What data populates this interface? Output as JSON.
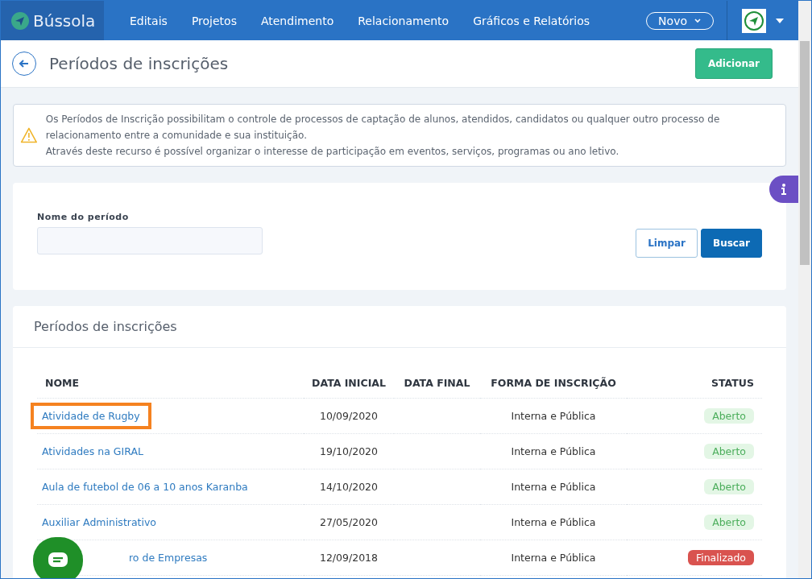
{
  "brand": "Bússola",
  "nav": [
    {
      "label": "Editais"
    },
    {
      "label": "Projetos"
    },
    {
      "label": "Atendimento"
    },
    {
      "label": "Relacionamento"
    },
    {
      "label": "Gráficos e Relatórios"
    }
  ],
  "new_button": "Novo",
  "page_title": "Períodos de inscrições",
  "add_button": "Adicionar",
  "alert": [
    "Os Períodos de Inscrição possibilitam o controle de processos de captação de alunos, atendidos, candidatos ou qualquer outro processo de relacionamento entre a comunidade e sua instituição.",
    "Através deste recurso é possível organizar o interesse de participação em eventos, serviços, programas ou ano letivo."
  ],
  "filter": {
    "label": "Nome do período",
    "clear_button": "Limpar",
    "search_button": "Buscar"
  },
  "table": {
    "title": "Períodos de inscrições",
    "columns": [
      "NOME",
      "DATA INICIAL",
      "DATA FINAL",
      "FORMA DE INSCRIÇÃO",
      "STATUS"
    ],
    "rows": [
      {
        "name": "Atividade de Rugby",
        "start": "10/09/2020",
        "end": "",
        "form": "Interna e Pública",
        "status": "Aberto",
        "color": "#e3f6e5",
        "highlighted": true,
        "covered": false
      },
      {
        "name": "Atividades na GIRAL",
        "start": "19/10/2020",
        "end": "",
        "form": "Interna e Pública",
        "status": "Aberto",
        "color": "#e3f6e5",
        "highlighted": false,
        "covered": false
      },
      {
        "name": "Aula de futebol de 06 a 10 anos Karanba",
        "start": "14/10/2020",
        "end": "",
        "form": "Interna e Pública",
        "status": "Aberto",
        "color": "#e3f6e5",
        "highlighted": false,
        "covered": false
      },
      {
        "name": "Auxiliar Administrativo",
        "start": "27/05/2020",
        "end": "",
        "form": "Interna e Pública",
        "status": "Aberto",
        "color": "#e3f6e5",
        "highlighted": false,
        "covered": false
      },
      {
        "name": "ro de Empresas",
        "start": "12/09/2018",
        "end": "",
        "form": "Interna e Pública",
        "status": "Finalizado",
        "color": "#d9534f",
        "highlighted": false,
        "covered": true
      }
    ]
  }
}
